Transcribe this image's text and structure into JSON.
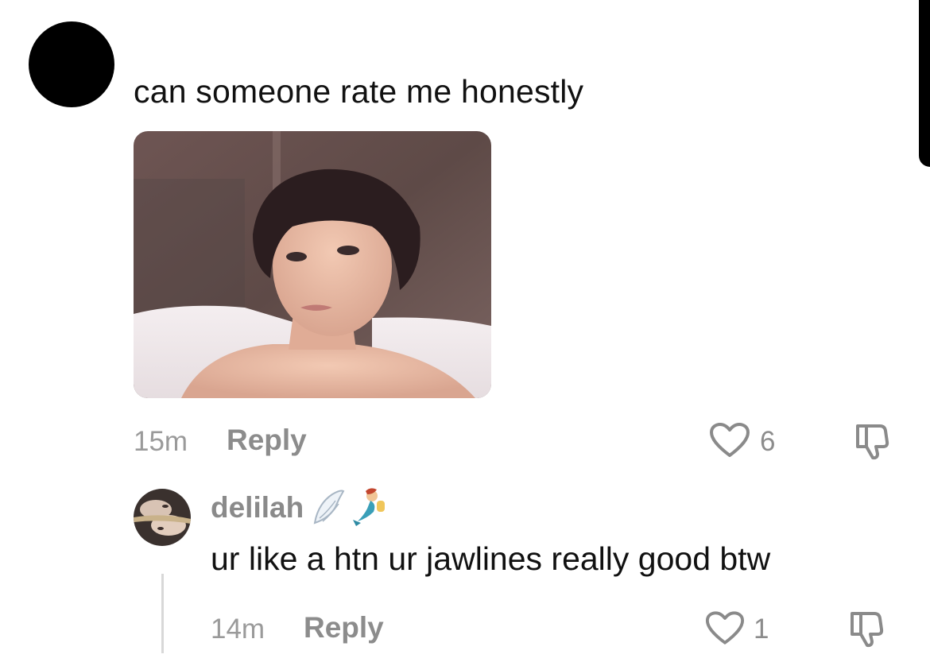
{
  "comment": {
    "text": "can someone rate me honestly",
    "time": "15m",
    "reply_label": "Reply",
    "likes": "6"
  },
  "reply": {
    "username": "delilah",
    "username_emojis": [
      "angel-wing-icon",
      "mermaid-icon"
    ],
    "text": "ur like a htn ur jawlines really good btw",
    "time": "14m",
    "reply_label": "Reply",
    "likes": "1"
  },
  "colors": {
    "text_primary": "#111111",
    "text_secondary": "#8c8c8c",
    "divider": "#d8d8d8"
  }
}
